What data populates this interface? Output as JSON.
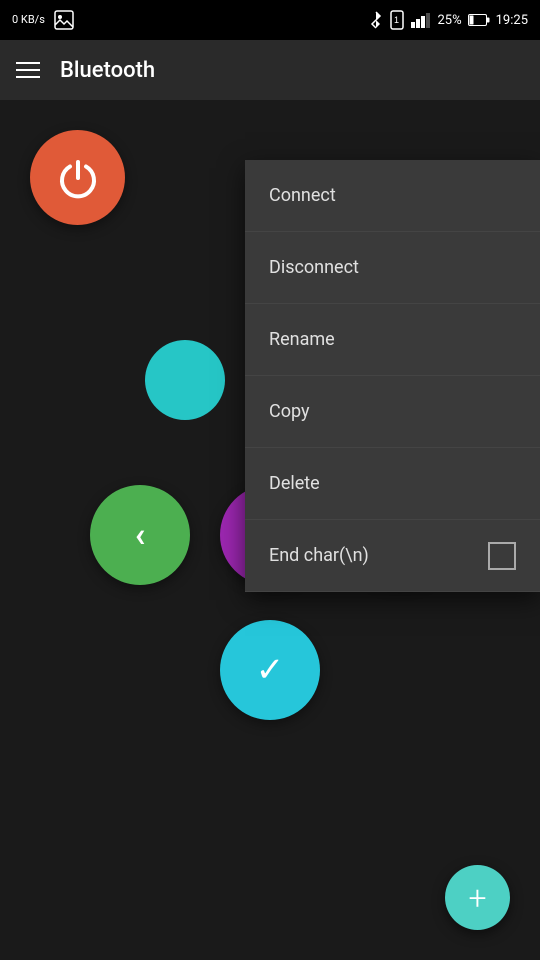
{
  "statusBar": {
    "data": "0\nKB/s",
    "battery": "25%",
    "time": "19:25"
  },
  "appBar": {
    "title": "Bluetooth",
    "menuLabel": "Menu"
  },
  "dropdownMenu": {
    "items": [
      {
        "id": "connect",
        "label": "Connect",
        "hasCheckbox": false
      },
      {
        "id": "disconnect",
        "label": "Disconnect",
        "hasCheckbox": false
      },
      {
        "id": "rename",
        "label": "Rename",
        "hasCheckbox": false
      },
      {
        "id": "copy",
        "label": "Copy",
        "hasCheckbox": false
      },
      {
        "id": "delete",
        "label": "Delete",
        "hasCheckbox": false
      },
      {
        "id": "end-char",
        "label": "End char(\\n)",
        "hasCheckbox": true
      }
    ]
  },
  "controls": {
    "backLabel": "‹",
    "closeLabel": "✕",
    "forwardLabel": "›",
    "downLabel": "✓",
    "fabLabel": "+"
  }
}
